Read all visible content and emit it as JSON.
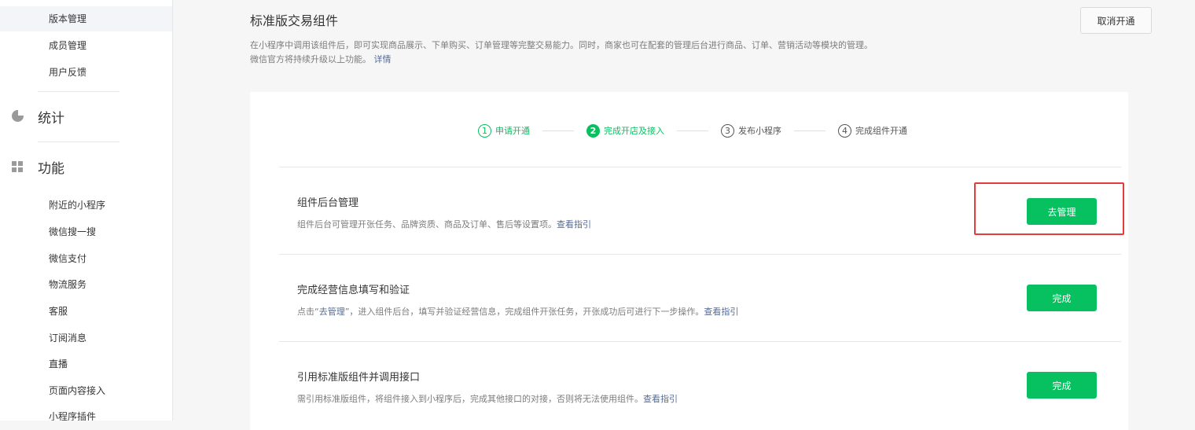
{
  "sidebar": {
    "top_items": [
      {
        "label": "版本管理",
        "active": true
      },
      {
        "label": "成员管理"
      },
      {
        "label": "用户反馈"
      }
    ],
    "groups": [
      {
        "label": "统计",
        "icon": "pie-chart-icon"
      },
      {
        "label": "功能",
        "icon": "grid-icon"
      }
    ],
    "feature_items": [
      {
        "label": "附近的小程序"
      },
      {
        "label": "微信搜一搜"
      },
      {
        "label": "微信支付"
      },
      {
        "label": "物流服务"
      },
      {
        "label": "客服"
      },
      {
        "label": "订阅消息"
      },
      {
        "label": "直播"
      },
      {
        "label": "页面内容接入"
      },
      {
        "label": "小程序插件"
      }
    ]
  },
  "header": {
    "title": "标准版交易组件",
    "cancel_label": "取消开通",
    "desc_line1": "在小程序中调用该组件后，即可实现商品展示、下单购买、订单管理等完整交易能力。同时，商家也可在配套的管理后台进行商品、订单、营销活动等模块的管理。",
    "desc_line2": "微信官方将持续升级以上功能。",
    "desc_link": "详情"
  },
  "steps": [
    {
      "num": "1",
      "label": "申请开通",
      "state": "done"
    },
    {
      "num": "2",
      "label": "完成开店及接入",
      "state": "current"
    },
    {
      "num": "3",
      "label": "发布小程序",
      "state": "todo"
    },
    {
      "num": "4",
      "label": "完成组件开通",
      "state": "todo"
    }
  ],
  "tasks": [
    {
      "title": "组件后台管理",
      "desc": "组件后台可管理开张任务、品牌资质、商品及订单、售后等设置项。",
      "link": "查看指引",
      "button": "去管理"
    },
    {
      "title": "完成经营信息填写和验证",
      "desc_prefix": "点击“",
      "desc_highlight": "去管理",
      "desc_suffix": "”，进入组件后台，填写并验证经营信息，完成组件开张任务，开张成功后可进行下一步操作。",
      "link": "查看指引",
      "button": "完成"
    },
    {
      "title": "引用标准版组件并调用接口",
      "desc": "需引用标准版组件，将组件接入到小程序后，完成其他接口的对接，否则将无法使用组件。",
      "link": "查看指引",
      "button": "完成"
    }
  ],
  "colors": {
    "accent_green": "#07c160",
    "link_blue": "#576b95",
    "highlight_red": "#e63b3b"
  }
}
